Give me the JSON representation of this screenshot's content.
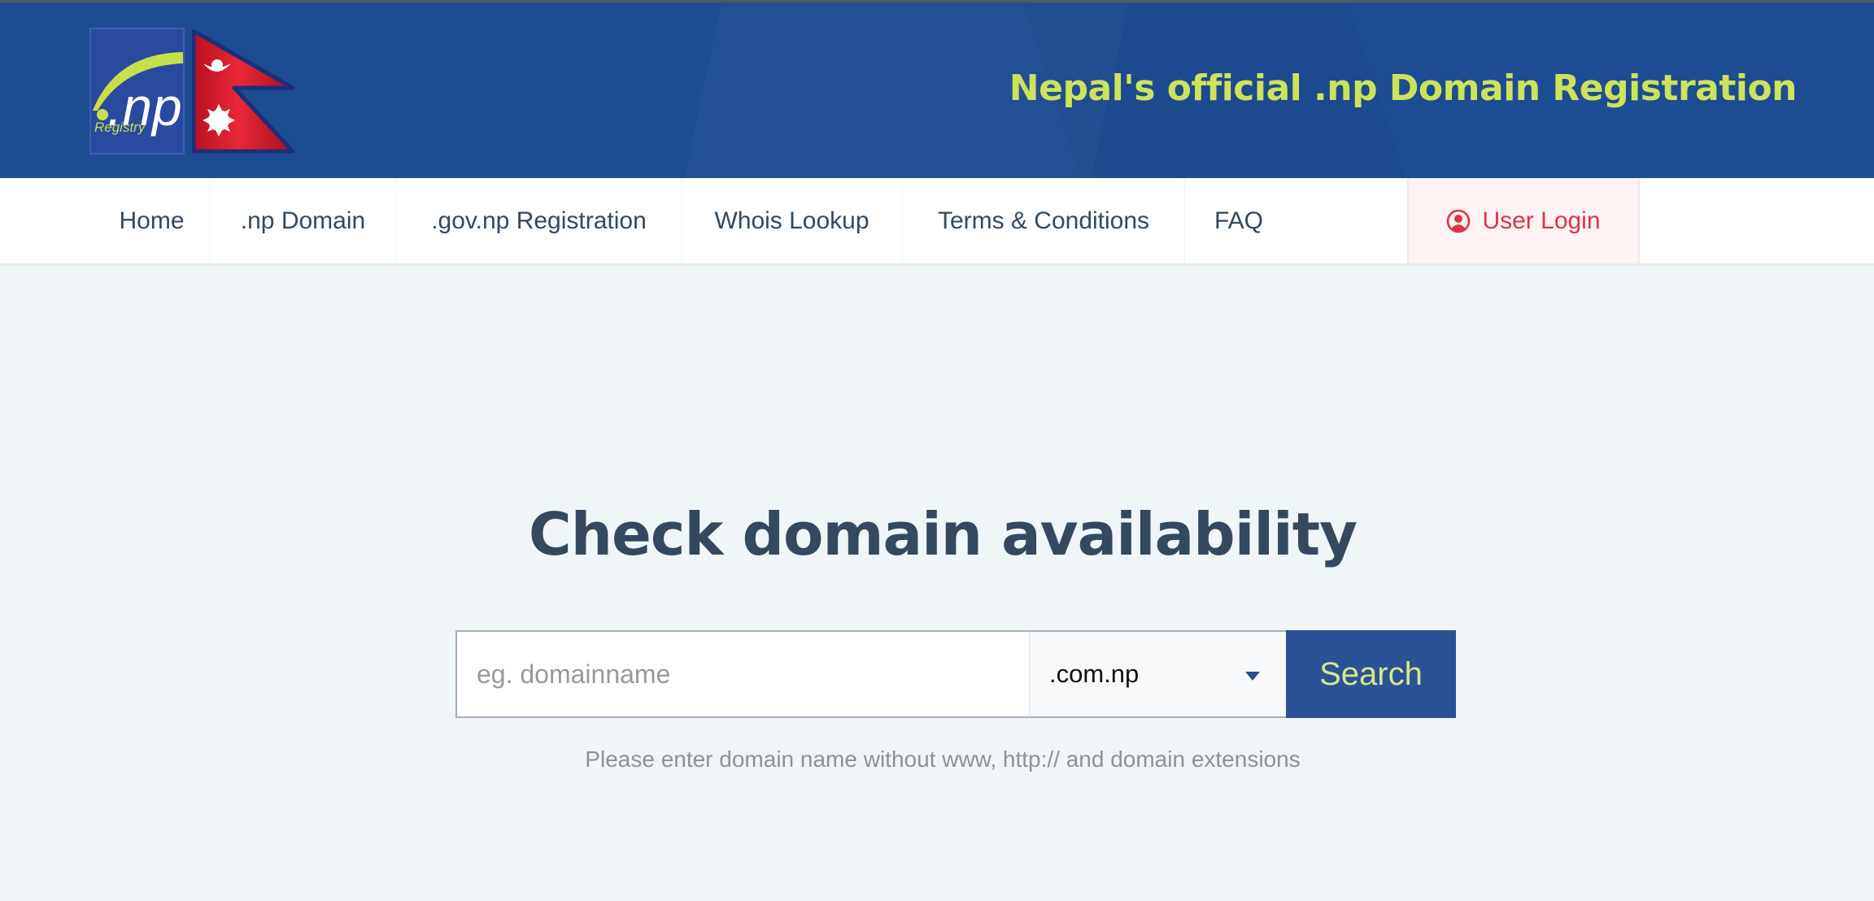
{
  "header": {
    "logo_text": ".np",
    "logo_subtext": "Registry",
    "tagline": "Nepal's official .np Domain Registration",
    "tagline_color": "#cde35a",
    "background_color": "#1e4c93"
  },
  "nav": {
    "items": [
      {
        "label": "Home"
      },
      {
        "label": ".np Domain"
      },
      {
        "label": ".gov.np Registration"
      },
      {
        "label": "Whois Lookup"
      },
      {
        "label": "Terms & Conditions"
      },
      {
        "label": "FAQ"
      }
    ],
    "login": {
      "label": "User Login",
      "icon": "user-circle-icon",
      "color": "#dc3545"
    }
  },
  "main": {
    "title": "Check domain availability",
    "search": {
      "placeholder": "eg. domainname",
      "value": "",
      "extension_selected": ".com.np",
      "button_label": "Search",
      "button_color": "#2b5295"
    },
    "hint": "Please enter domain name without www, http:// and domain extensions"
  }
}
